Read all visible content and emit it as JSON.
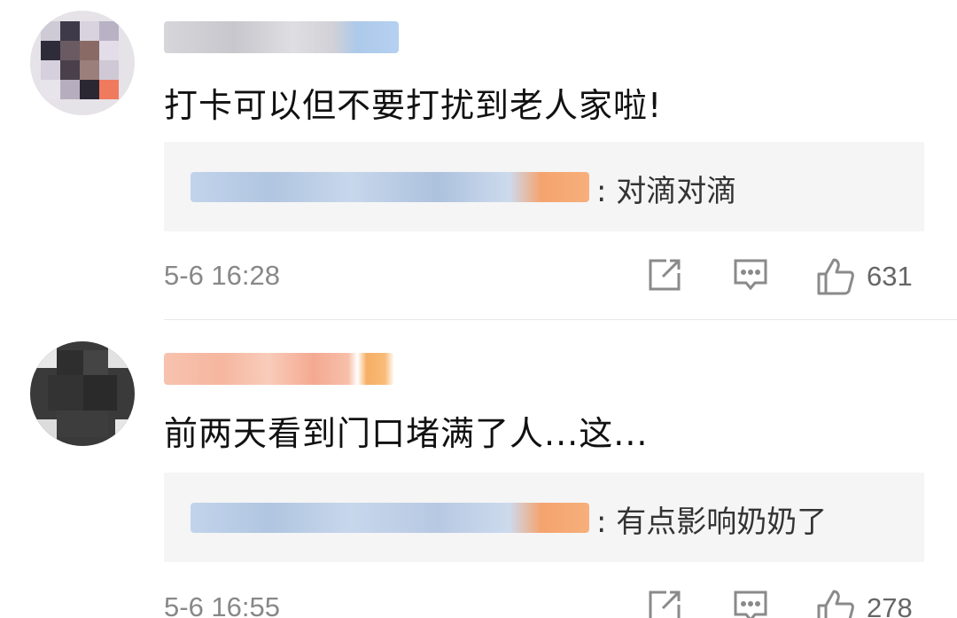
{
  "comments": [
    {
      "text": "打卡可以但不要打扰到老人家啦!",
      "reply": {
        "text": ": 对滴对滴"
      },
      "timestamp": "5-6 16:28",
      "likes": "631",
      "icons": [
        "share-icon",
        "comment-icon",
        "thumbs-up-icon"
      ]
    },
    {
      "text": "前两天看到门口堵满了人...这...",
      "reply": {
        "text": ": 有点影响奶奶了"
      },
      "timestamp": "5-6 16:55",
      "likes": "278",
      "icons": [
        "share-icon",
        "comment-icon",
        "thumbs-up-icon"
      ]
    }
  ],
  "colors": {
    "background": "#ffffff",
    "reply_box": "#f5f5f6",
    "meta_text": "#888888",
    "icon_stroke": "#8a8a8a",
    "blur_blue": "#9fc0e6",
    "blur_orange": "#f59a5e"
  }
}
